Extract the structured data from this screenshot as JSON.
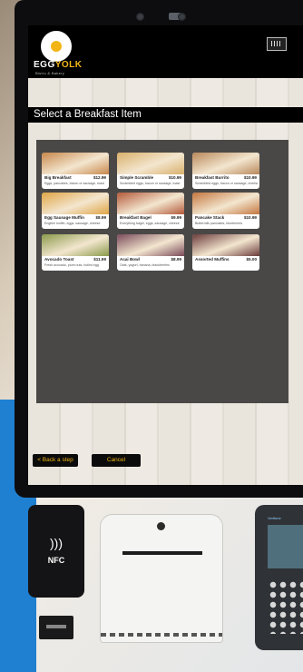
{
  "app": {
    "brand_part1": "EGG",
    "brand_part2": "YOLK",
    "tagline": "Bistro & Bakery"
  },
  "header": {
    "scan_icon": "barcode-scan-icon"
  },
  "page_title": "Select a Breakfast Item",
  "menu_items": [
    {
      "name": "Big Breakfast",
      "price": "$12.99",
      "desc": "Eggs, pancakes, bacon or sausage, toast",
      "color": "#c8874b"
    },
    {
      "name": "Simple Scramble",
      "price": "$10.99",
      "desc": "Scrambled eggs, bacon or sausage, toast",
      "color": "#d9b06a"
    },
    {
      "name": "Breakfast Burrito",
      "price": "$10.99",
      "desc": "Scrambled eggs, bacon or sausage, cheese",
      "color": "#b9885a"
    },
    {
      "name": "Egg Sausage Muffin",
      "price": "$8.99",
      "desc": "English muffin, eggs, sausage, cheese",
      "color": "#e0a545"
    },
    {
      "name": "Breakfast Bagel",
      "price": "$9.99",
      "desc": "Everything bagel, eggs, sausage, cheese",
      "color": "#b45a3a"
    },
    {
      "name": "Pancake Stack",
      "price": "$10.99",
      "desc": "Buttermilk pancakes, blueberries",
      "color": "#c4763f"
    },
    {
      "name": "Avocado Toast",
      "price": "$11.99",
      "desc": "Fresh avocado, plum nuts, boiled egg",
      "color": "#8a9a4a"
    },
    {
      "name": "Acai Bowl",
      "price": "$8.99",
      "desc": "Oats, yogurt, banana, blackberries",
      "color": "#7a4a5a"
    },
    {
      "name": "Assorted Muffins",
      "price": "$5.00",
      "desc": "",
      "color": "#6a3a3a"
    }
  ],
  "buttons": {
    "back": "< Back a step",
    "cancel": "Cancel"
  },
  "hardware": {
    "nfc_label": "NFC",
    "terminal_label": "Verifone"
  },
  "colors": {
    "accent": "#f2b516",
    "panel": "#4a4847",
    "bar": "#000000"
  }
}
